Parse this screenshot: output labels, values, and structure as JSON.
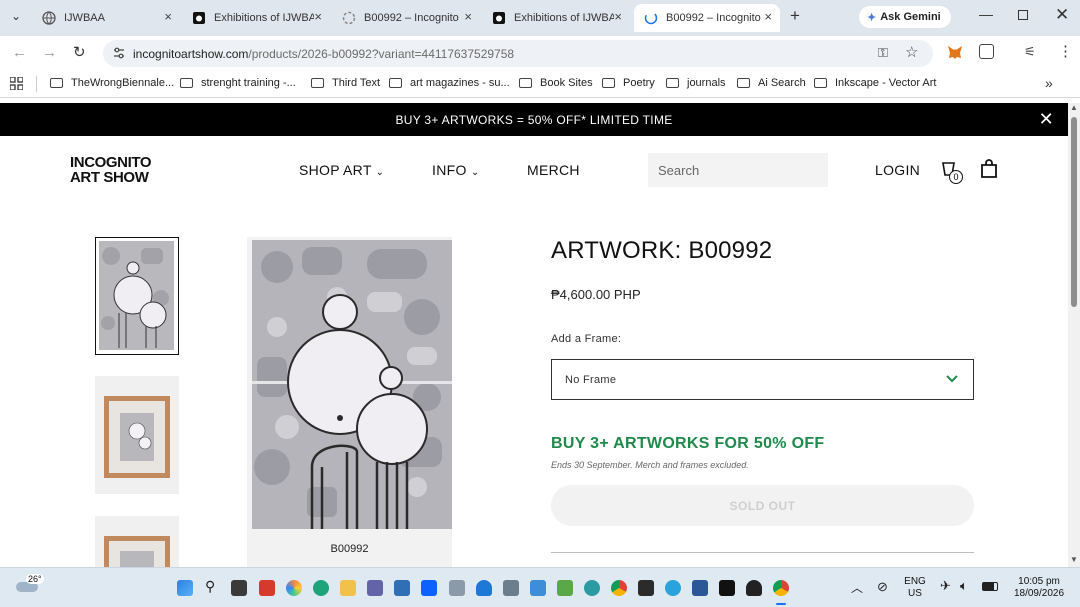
{
  "browser": {
    "tabs": [
      {
        "label": "IJWBAA",
        "active": false
      },
      {
        "label": "Exhibitions of IJWBA",
        "active": false
      },
      {
        "label": "B00992 – Incognito",
        "active": false
      },
      {
        "label": "Exhibitions of IJWBA",
        "active": false
      },
      {
        "label": "B00992 – Incognito",
        "active": true
      }
    ],
    "ask_gemini": "Ask Gemini",
    "url_host": "incognitoartshow.com",
    "url_path": "/products/2026-b00992?variant=44117637529758",
    "bookmarks": [
      {
        "label": "TheWrongBiennale..."
      },
      {
        "label": "strenght training -..."
      },
      {
        "label": "Third Text"
      },
      {
        "label": "art magazines - su..."
      },
      {
        "label": "Book Sites"
      },
      {
        "label": "Poetry"
      },
      {
        "label": "journals"
      },
      {
        "label": "Ai Search"
      },
      {
        "label": "Inkscape - Vector Art"
      }
    ]
  },
  "site": {
    "promo_banner": "BUY 3+ ARTWORKS = 50% OFF* LIMITED TIME",
    "logo_line1": "INCOGNITO",
    "logo_line2": "ART SHOW",
    "nav": {
      "shop_art": "SHOP ART",
      "info": "INFO",
      "merch": "MERCH",
      "login": "LOGIN",
      "cart_count": "0"
    },
    "search_placeholder": "Search"
  },
  "product": {
    "title": "ARTWORK: B00992",
    "price": "₱4,600.00 PHP",
    "frame_label": "Add a Frame:",
    "frame_value": "No Frame",
    "deal_heading": "BUY 3+ ARTWORKS FOR 50% OFF",
    "deal_note": "Ends 30 September. Merch and frames excluded.",
    "button_label": "SOLD OUT",
    "image_caption": "B00992"
  },
  "taskbar": {
    "weather": "26°",
    "lang_line1": "ENG",
    "lang_line2": "US",
    "time": "10:05 pm",
    "date": "18/09/2026"
  },
  "colors": {
    "promo_bg": "#000000",
    "deal_green": "#1f8a4c",
    "tab_strip": "#dfe6ee"
  }
}
